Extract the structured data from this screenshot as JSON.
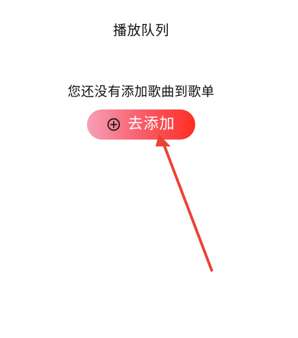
{
  "header": {
    "title": "播放队列"
  },
  "empty_state": {
    "message": "您还没有添加歌曲到歌单",
    "add_button": {
      "label": "去添加",
      "icon": "plus-circle-icon",
      "gradient_start": "#f6a0b7",
      "gradient_end": "#ff2e22"
    }
  },
  "annotation": {
    "arrow_color": "#e94335"
  }
}
